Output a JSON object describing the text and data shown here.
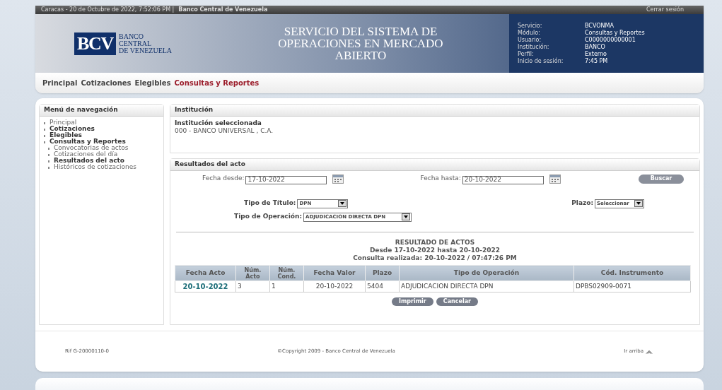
{
  "top_bar": {
    "datetime": "Caracas - 20 de Octubre de 2022, 7:52:06 PM |",
    "bank": "Banco Central de Venezuela",
    "logout": "Cerrar sesión"
  },
  "banner": {
    "logo_mark": "BCV",
    "logo_lines": [
      "BANCO",
      "CENTRAL",
      "DE VENEZUELA"
    ],
    "title_lines": [
      "SERVICIO DEL SISTEMA DE",
      "OPERACIONES EN MERCADO",
      "ABIERTO"
    ],
    "session": [
      {
        "label": "Servicio:",
        "value": "BCVONMA"
      },
      {
        "label": "Módulo:",
        "value": "Consultas y Reportes"
      },
      {
        "label": "Usuario:",
        "value": "C0000000000001"
      },
      {
        "label": "Institución:",
        "value": "BANCO"
      },
      {
        "label": "Perfil:",
        "value": "Externo"
      },
      {
        "label": "Inicio de sesión:",
        "value": "7:45 PM"
      }
    ]
  },
  "main_nav": [
    {
      "label": "Principal",
      "selected": false
    },
    {
      "label": "Cotizaciones",
      "selected": false
    },
    {
      "label": "Elegibles",
      "selected": false
    },
    {
      "label": "Consultas y Reportes",
      "selected": true
    }
  ],
  "sidebar": {
    "title": "Menú de navegación",
    "items": [
      {
        "label": "Principal",
        "bold": false
      },
      {
        "label": "Cotizaciones",
        "bold": true
      },
      {
        "label": "Elegibles",
        "bold": true
      },
      {
        "label": "Consultas y Reportes",
        "bold": true,
        "children": [
          {
            "label": "Convocatorias de actos",
            "bold": false
          },
          {
            "label": "Cotizaciones del día",
            "bold": false
          },
          {
            "label": "Resultados del acto",
            "bold": true
          },
          {
            "label": "Históricos de cotizaciones",
            "bold": false
          }
        ]
      }
    ]
  },
  "institution": {
    "title": "Institución",
    "label": "Institución seleccionada",
    "value": "000 - BANCO UNIVERSAL , C.A."
  },
  "results": {
    "title": "Resultados del acto",
    "fecha_desde": {
      "label": "Fecha desde:",
      "value": "17-10-2022"
    },
    "fecha_hasta": {
      "label": "Fecha hasta:",
      "value": "20-10-2022"
    },
    "search_button": "Buscar",
    "tipo_titulo": {
      "label": "Tipo de Título:",
      "value": "DPN"
    },
    "plazo": {
      "label": "Plazo:",
      "value": "Seleccionar"
    },
    "tipo_operacion": {
      "label": "Tipo de Operación:",
      "value": "ADJUDICACION DIRECTA DPN"
    },
    "report_title": "RESULTADO DE ACTOS",
    "report_range": "Desde 17-10-2022 hasta 20-10-2022",
    "report_time": "Consulta realizada: 20-10-2022 / 07:47:26 PM",
    "table": {
      "columns": [
        "Fecha Acto",
        "Núm. Acto",
        "Núm. Cond.",
        "Fecha Valor",
        "Plazo",
        "Tipo de Operación",
        "Cód. Instrumento"
      ],
      "rows": [
        [
          "20-10-2022",
          "3",
          "1",
          "20-10-2022",
          "5404",
          "ADJUDICACION DIRECTA DPN",
          "DPBS02909-0071"
        ]
      ]
    },
    "buttons": [
      "Imprimir",
      "Cancelar"
    ]
  },
  "footer": {
    "rif": "Rif G-20000110-0",
    "copyright": "©Copyright 2009 - Banco Central de Venezuela",
    "top_link": "Ir arriba"
  }
}
